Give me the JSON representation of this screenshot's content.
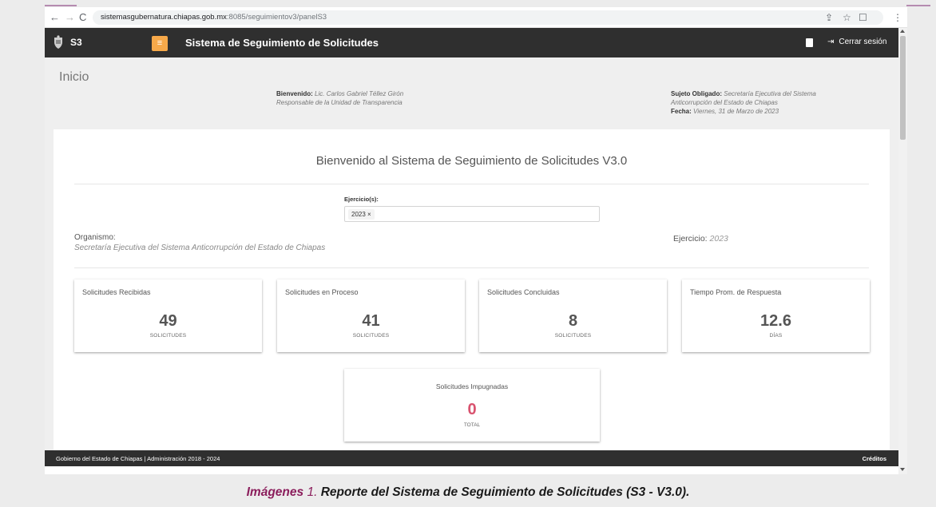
{
  "browser": {
    "url_host": "sistemasgubernatura.chiapas.gob.mx",
    "url_path": ":8085/seguimientov3/panelS3"
  },
  "navbar": {
    "brand": "S3",
    "title": "Sistema de Seguimiento de Solicitudes",
    "logout_label": "Cerrar sesión"
  },
  "header": {
    "page_title": "Inicio",
    "welcome_label": "Bienvenido:",
    "welcome_name": "Lic. Carlos Gabriel Téllez Girón",
    "welcome_role": "Responsable de la Unidad de Transparencia",
    "sujeto_label": "Sujeto Obligado:",
    "sujeto_value_1": "Secretaría Ejecutiva del Sistema",
    "sujeto_value_2": "Anticorrupción del Estado de Chiapas",
    "fecha_label": "Fecha:",
    "fecha_value": "Viernes, 31 de Marzo de 2023"
  },
  "main": {
    "welcome": "Bienvenido al Sistema de Seguimiento de Solicitudes V3.0",
    "ejercicio_label": "Ejercicio(s):",
    "ejercicio_chip": "2023 ×",
    "organismo_label": "Organismo:",
    "organismo_value": "Secretaría Ejecutiva del Sistema Anticorrupción del Estado de Chiapas",
    "ejercicio_right_label": "Ejercicio:",
    "ejercicio_right_value": "2023",
    "stats": [
      {
        "label": "Solicitudes Recibidas",
        "value": "49",
        "unit": "SOLICITUDES"
      },
      {
        "label": "Solicitudes en Proceso",
        "value": "41",
        "unit": "SOLICITUDES"
      },
      {
        "label": "Solicitudes Concluidas",
        "value": "8",
        "unit": "SOLICITUDES"
      },
      {
        "label": "Tiempo Prom. de Respuesta",
        "value": "12.6",
        "unit": "DÍAS"
      }
    ],
    "impugnadas": {
      "label": "Solicitudes Impugnadas",
      "value": "0",
      "unit": "TOTAL"
    }
  },
  "footer": {
    "left": "Gobierno del Estado de Chiapas | Administración 2018 - 2024",
    "right": "Créditos"
  },
  "caption": {
    "lead": "Imágenes",
    "number": "1.",
    "text": "Reporte del Sistema de Seguimiento de Solicitudes (S3 - V3.0)."
  },
  "colors": {
    "navbar": "#2f2f2f",
    "menu_button": "#f7a94a",
    "impugnadas_value": "#d9536f",
    "caption_accent": "#8b1e5c"
  }
}
